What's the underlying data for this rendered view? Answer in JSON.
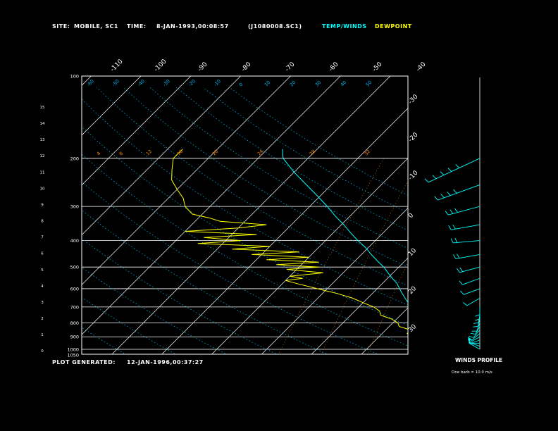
{
  "header": {
    "site_label": "SITE:",
    "site_value": "MOBILE, SC1",
    "time_label": "TIME:",
    "time_value": "8-JAN-1993,00:08:57",
    "file_id": "(J1080008.SC1)",
    "temp_legend": "TEMP/WINDS",
    "dewpoint_legend": "DEWPOINT"
  },
  "footer": {
    "generated_label": "PLOT GENERATED:",
    "generated_value": "12-JAN-1996,00:37:27"
  },
  "wind_panel": {
    "title": "WINDS PROFILE",
    "note": "One barb = 10.0 m/s"
  },
  "colors": {
    "background": "#000000",
    "temperature": "#00ffff",
    "dewpoint": "#ffff00",
    "grid": "#ffffff",
    "mixing_ratio": "#ff8800",
    "moist_adiabat": "#00bfff",
    "labels": "#ffffff"
  },
  "chart_data": {
    "type": "line",
    "title": "",
    "y_axis_pressure": {
      "label": "",
      "ticks": [
        "100",
        "200",
        "300",
        "400",
        "500",
        "600",
        "700",
        "800",
        "900",
        "1000",
        "1050"
      ],
      "ylim": [
        1050,
        100
      ],
      "scale": "log"
    },
    "y_axis_height_km": {
      "ticks": [
        "15",
        "14",
        "13",
        "12",
        "11",
        "10",
        "9",
        "8",
        "7",
        "6",
        "5",
        "4",
        "3",
        "2",
        "1",
        "0"
      ]
    },
    "isotherm_labels_top": [
      "-110",
      "-100",
      "-90",
      "-80",
      "-70",
      "-60",
      "-50",
      "-40"
    ],
    "isotherm_labels_right": [
      "-30",
      "-20",
      "-10",
      "0",
      "10",
      "20",
      "30"
    ],
    "mixing_ratio_labels": [
      "4",
      "8",
      "12",
      "16",
      "20",
      "24",
      "28",
      "32"
    ],
    "adiabat_labels_top": [
      "-60",
      "-50",
      "-40",
      "-30",
      "-20",
      "-10",
      "0",
      "10",
      "20",
      "30",
      "40",
      "50"
    ],
    "series": [
      {
        "name": "TEMP",
        "points": [
          {
            "p": 1000,
            "t": 17.5
          },
          {
            "p": 975,
            "t": 15.5
          },
          {
            "p": 950,
            "t": 14
          },
          {
            "p": 925,
            "t": 12.5
          },
          {
            "p": 900,
            "t": 11.5
          },
          {
            "p": 875,
            "t": 10
          },
          {
            "p": 850,
            "t": 9
          },
          {
            "p": 825,
            "t": 8.5
          },
          {
            "p": 800,
            "t": 7
          },
          {
            "p": 775,
            "t": 5.5
          },
          {
            "p": 750,
            "t": 4
          },
          {
            "p": 725,
            "t": 2.5
          },
          {
            "p": 700,
            "t": 1
          },
          {
            "p": 675,
            "t": -1
          },
          {
            "p": 650,
            "t": -2.5
          },
          {
            "p": 625,
            "t": -4
          },
          {
            "p": 600,
            "t": -5.5
          },
          {
            "p": 575,
            "t": -7
          },
          {
            "p": 550,
            "t": -9
          },
          {
            "p": 525,
            "t": -11
          },
          {
            "p": 500,
            "t": -13
          },
          {
            "p": 475,
            "t": -15.5
          },
          {
            "p": 450,
            "t": -18
          },
          {
            "p": 425,
            "t": -20.5
          },
          {
            "p": 400,
            "t": -23.5
          },
          {
            "p": 375,
            "t": -26.5
          },
          {
            "p": 350,
            "t": -29.5
          },
          {
            "p": 325,
            "t": -33
          },
          {
            "p": 300,
            "t": -36.5
          },
          {
            "p": 275,
            "t": -40.5
          },
          {
            "p": 250,
            "t": -45
          },
          {
            "p": 225,
            "t": -50
          },
          {
            "p": 200,
            "t": -55
          },
          {
            "p": 185,
            "t": -57
          }
        ]
      },
      {
        "name": "DEWPOINT",
        "points": [
          {
            "p": 1000,
            "t": 12
          },
          {
            "p": 975,
            "t": 11
          },
          {
            "p": 950,
            "t": 10
          },
          {
            "p": 925,
            "t": 9
          },
          {
            "p": 900,
            "t": 7
          },
          {
            "p": 875,
            "t": 5
          },
          {
            "p": 850,
            "t": 5
          },
          {
            "p": 825,
            "t": 2
          },
          {
            "p": 800,
            "t": 1
          },
          {
            "p": 775,
            "t": -1
          },
          {
            "p": 750,
            "t": -4
          },
          {
            "p": 725,
            "t": -5
          },
          {
            "p": 700,
            "t": -7
          },
          {
            "p": 675,
            "t": -10
          },
          {
            "p": 650,
            "t": -13
          },
          {
            "p": 625,
            "t": -17
          },
          {
            "p": 600,
            "t": -22
          },
          {
            "p": 575,
            "t": -27
          },
          {
            "p": 560,
            "t": -30
          },
          {
            "p": 550,
            "t": -27
          },
          {
            "p": 540,
            "t": -30
          },
          {
            "p": 525,
            "t": -24
          },
          {
            "p": 510,
            "t": -32
          },
          {
            "p": 500,
            "t": -26
          },
          {
            "p": 490,
            "t": -35
          },
          {
            "p": 480,
            "t": -27
          },
          {
            "p": 470,
            "t": -38
          },
          {
            "p": 460,
            "t": -30
          },
          {
            "p": 450,
            "t": -42
          },
          {
            "p": 440,
            "t": -33
          },
          {
            "p": 430,
            "t": -47
          },
          {
            "p": 420,
            "t": -40
          },
          {
            "p": 410,
            "t": -55
          },
          {
            "p": 400,
            "t": -47
          },
          {
            "p": 390,
            "t": -55
          },
          {
            "p": 380,
            "t": -45
          },
          {
            "p": 370,
            "t": -60
          },
          {
            "p": 360,
            "t": -50
          },
          {
            "p": 350,
            "t": -45
          },
          {
            "p": 340,
            "t": -55
          },
          {
            "p": 330,
            "t": -58
          },
          {
            "p": 320,
            "t": -62
          },
          {
            "p": 300,
            "t": -65
          },
          {
            "p": 280,
            "t": -67
          },
          {
            "p": 260,
            "t": -70
          },
          {
            "p": 240,
            "t": -73
          },
          {
            "p": 220,
            "t": -75
          },
          {
            "p": 200,
            "t": -77
          },
          {
            "p": 185,
            "t": -77
          }
        ]
      }
    ],
    "winds": [
      {
        "p": 1000,
        "dir": 300,
        "spd": 8
      },
      {
        "p": 975,
        "dir": 290,
        "spd": 7
      },
      {
        "p": 950,
        "dir": 270,
        "spd": 6
      },
      {
        "p": 925,
        "dir": 250,
        "spd": 5
      },
      {
        "p": 900,
        "dir": 240,
        "spd": 5
      },
      {
        "p": 875,
        "dir": 230,
        "spd": 6
      },
      {
        "p": 850,
        "dir": 220,
        "spd": 6
      },
      {
        "p": 825,
        "dir": 210,
        "spd": 5
      },
      {
        "p": 800,
        "dir": 200,
        "spd": 5
      },
      {
        "p": 775,
        "dir": 195,
        "spd": 4
      },
      {
        "p": 750,
        "dir": 190,
        "spd": 4
      },
      {
        "p": 725,
        "dir": 180,
        "spd": 4
      },
      {
        "p": 700,
        "dir": 180,
        "spd": 4
      },
      {
        "p": 650,
        "dir": 240,
        "spd": 10
      },
      {
        "p": 600,
        "dir": 250,
        "spd": 12
      },
      {
        "p": 550,
        "dir": 250,
        "spd": 13
      },
      {
        "p": 500,
        "dir": 255,
        "spd": 15
      },
      {
        "p": 450,
        "dir": 260,
        "spd": 18
      },
      {
        "p": 400,
        "dir": 265,
        "spd": 20
      },
      {
        "p": 350,
        "dir": 260,
        "spd": 22
      },
      {
        "p": 300,
        "dir": 255,
        "spd": 25
      },
      {
        "p": 250,
        "dir": 250,
        "spd": 35
      },
      {
        "p": 200,
        "dir": 245,
        "spd": 45
      }
    ]
  }
}
